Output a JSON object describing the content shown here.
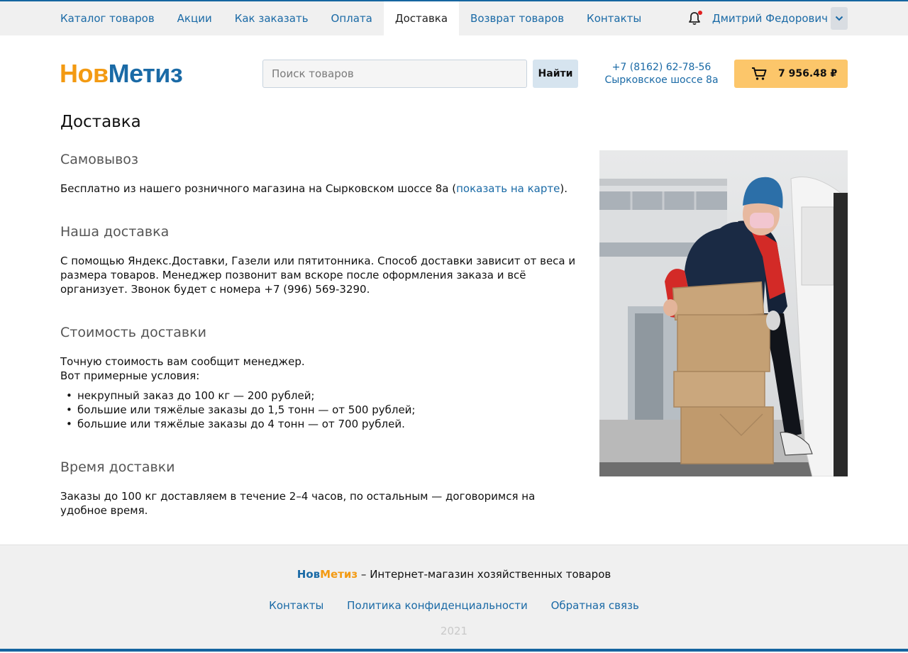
{
  "topnav": {
    "items": [
      {
        "label": "Каталог товаров"
      },
      {
        "label": "Акции"
      },
      {
        "label": "Как заказать"
      },
      {
        "label": "Оплата"
      },
      {
        "label": "Доставка",
        "active": true
      },
      {
        "label": "Возврат товаров"
      },
      {
        "label": "Контакты"
      }
    ],
    "user_name": "Дмитрий Федорович"
  },
  "header": {
    "logo_part1": "Нов",
    "logo_part2": "Метиз",
    "search_placeholder": "Поиск товаров",
    "search_button": "Найти",
    "phone": "+7 (8162) 62-78-56",
    "address": "Сырковское шоссе 8а",
    "cart_total": "7 956.48 ₽"
  },
  "page": {
    "title": "Доставка",
    "sections": {
      "pickup": {
        "heading": "Самовывоз",
        "text_before": "Бесплатно из нашего розничного магазина на Сырковском шоссе 8а (",
        "link": "показать на карте",
        "text_after": ")."
      },
      "our_delivery": {
        "heading": "Наша доставка",
        "text": "С помощью Яндекс.Доставки, Газели или пятитонника. Способ доставки зависит от веса и размера товаров. Менеджер позвонит вам вскоре после оформления заказа и всё организует. Звонок будет с номера +7 (996) 569-3290."
      },
      "cost": {
        "heading": "Стоимость доставки",
        "line1": "Точную стоимость вам сообщит менеджер.",
        "line2": "Вот примерные условия:",
        "items": [
          "некрупный заказ до 100 кг — 200 рублей;",
          "большие или тяжёлые заказы до 1,5 тонн — от 500 рублей;",
          "большие или тяжёлые заказы до 4 тонн — от 700 рублей."
        ]
      },
      "time": {
        "heading": "Время доставки",
        "text": "Заказы до 100 кг доставляем в течение 2–4 часов, по остальным — договоримся на удобное время."
      }
    }
  },
  "footer": {
    "brand1": "Нов",
    "brand2": "Метиз",
    "tagline": " – Интернет-магазин хозяйственных товаров",
    "links": [
      "Контакты",
      "Политика конфиденциальности",
      "Обратная связь"
    ],
    "year": "2021"
  },
  "colors": {
    "accent_blue": "#1a6aa6",
    "accent_orange": "#f39a12",
    "cart_bg": "#fcc66a"
  }
}
